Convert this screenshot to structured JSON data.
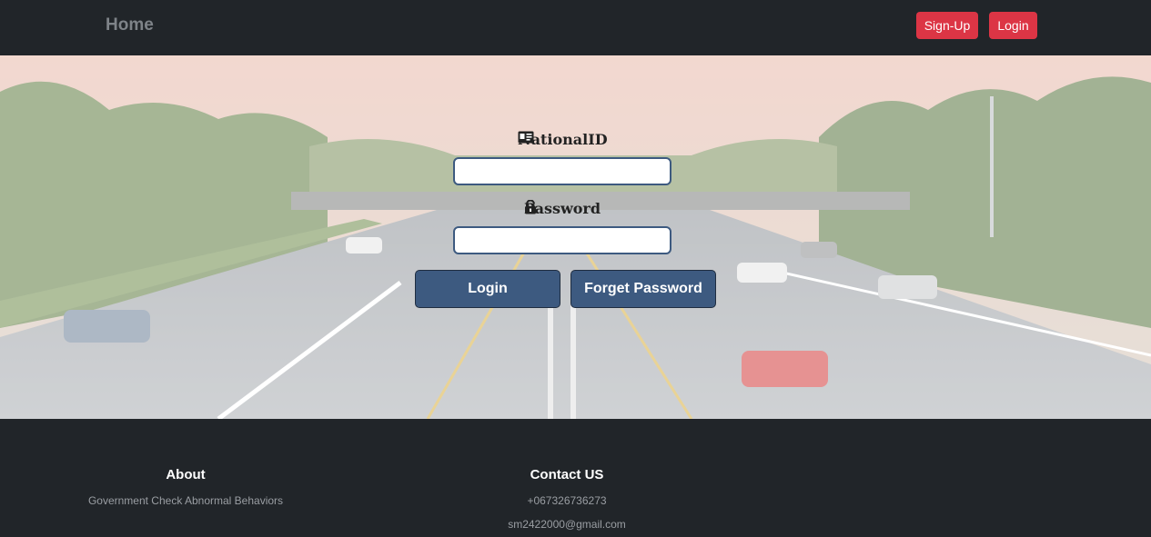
{
  "navbar": {
    "brand": "Home",
    "signup_label": "Sign-Up",
    "login_label": "Login"
  },
  "form": {
    "national_id_label": "NationalID",
    "national_id_icon": "id-card-icon",
    "national_id_value": "",
    "password_label": "Password",
    "password_icon": "unlock-icon",
    "password_value": "",
    "login_button": "Login",
    "forget_button": "Forget Password"
  },
  "footer": {
    "about_heading": "About",
    "about_text": "Government Check Abnormal Behaviors",
    "contact_heading": "Contact US",
    "phone": "+067326736273",
    "email": "sm2422000@gmail.com"
  },
  "colors": {
    "navbar_bg": "#212529",
    "accent_red": "#dc3545",
    "form_button": "#3d5a80",
    "footer_bg": "#212529"
  }
}
